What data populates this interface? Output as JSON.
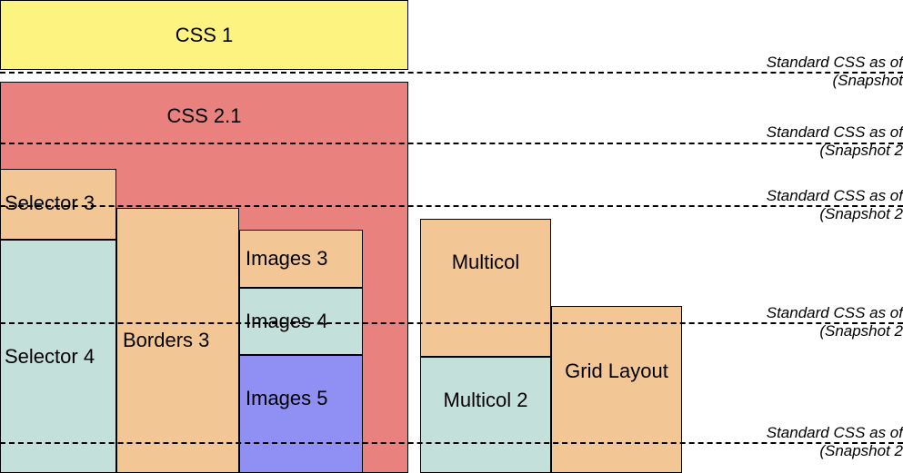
{
  "boxes": {
    "css1": "CSS 1",
    "css21": "CSS 2.1",
    "selector3": "Selector 3",
    "selector4": "Selector 4",
    "borders3": "Borders 3",
    "images3": "Images 3",
    "images4": "Images 4",
    "images5": "Images 5",
    "multicol": "Multicol",
    "multicol2": "Multicol 2",
    "gridlayout": "Grid Layout"
  },
  "labels": {
    "l1a": "Standard CSS as of",
    "l1b": "(Snapshot ",
    "l2a": "Standard CSS as of",
    "l2b": "(Snapshot 2",
    "l3a": "Standard CSS as of",
    "l3b": "(Snapshot 2",
    "l4a": "Standard CSS as of",
    "l4b": "(Snapshot 2",
    "l5a": "Standard CSS as of",
    "l5b": "(Snapshot 2"
  },
  "colors": {
    "yellow": "#fdf381",
    "red": "#e9827f",
    "orange": "#f3c795",
    "blue": "#c4e0db",
    "purple": "#8f8ff4"
  },
  "dash_y": [
    79,
    157,
    226,
    355,
    487
  ]
}
